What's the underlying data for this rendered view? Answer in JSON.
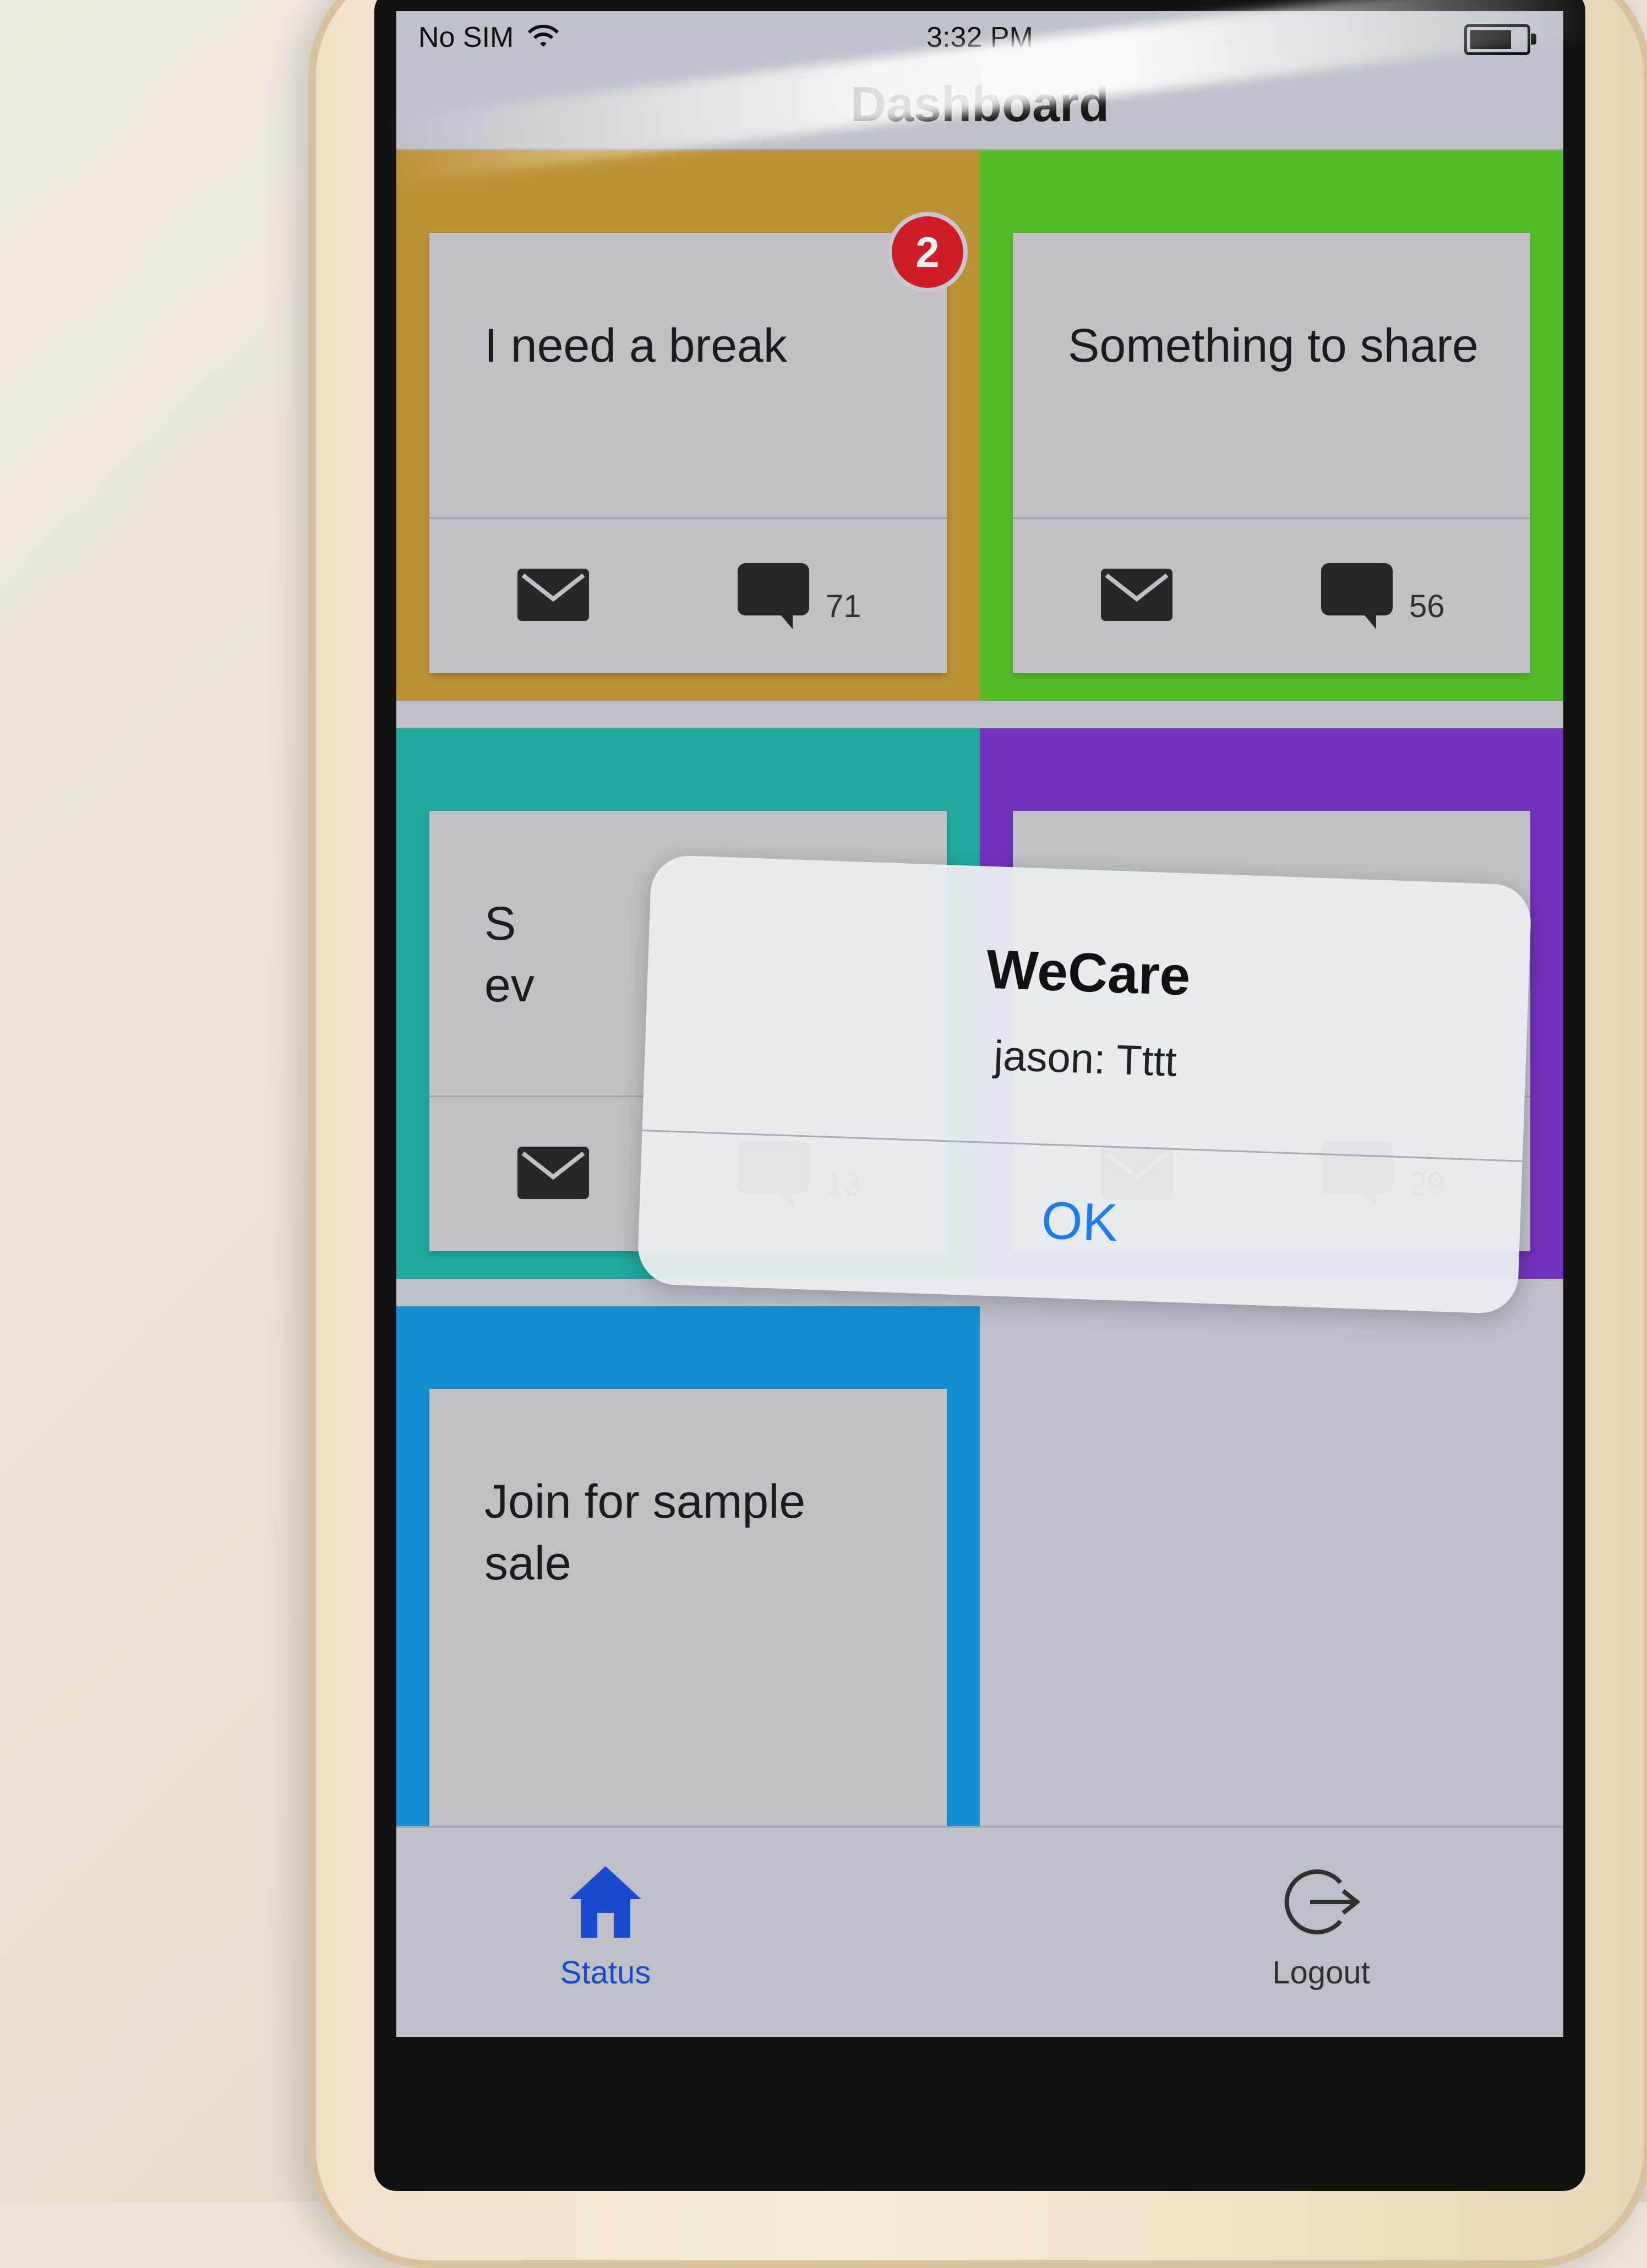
{
  "status_bar": {
    "carrier": "No SIM",
    "time": "3:32 PM"
  },
  "nav": {
    "title": "Dashboard"
  },
  "tiles": [
    {
      "title": "I need a break",
      "count": "71",
      "badge": "2",
      "color": "#c79a3a"
    },
    {
      "title": "Something to share",
      "count": "56",
      "badge": "",
      "color": "#5ac82a"
    },
    {
      "title": "S\nev",
      "count": "13",
      "badge": "",
      "color": "#22b2a6"
    },
    {
      "title": "",
      "count": "29",
      "badge": "",
      "color": "#7a36c8"
    },
    {
      "title": "Join for sample sale",
      "count": "",
      "badge": "",
      "color": "#1698dc"
    }
  ],
  "alert": {
    "title": "WeCare",
    "message": "jason: Tttt",
    "button": "OK"
  },
  "tab_bar": {
    "tabs": [
      {
        "label": "Status",
        "icon": "home-icon",
        "active": true
      },
      {
        "label": "Logout",
        "icon": "logout-icon",
        "active": false
      }
    ],
    "active_color": "#1d4ed8"
  }
}
